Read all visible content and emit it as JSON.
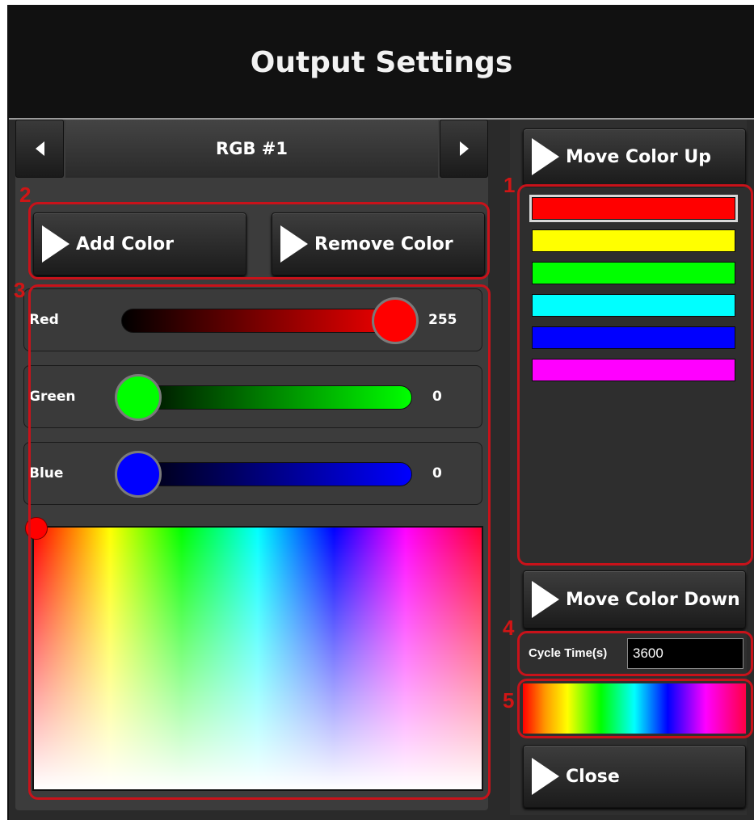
{
  "window": {
    "title": "Output Settings"
  },
  "nav": {
    "label": "RGB #1"
  },
  "buttons": {
    "add_color": "Add Color",
    "remove_color": "Remove Color",
    "move_up": "Move Color Up",
    "move_down": "Move Color Down",
    "close": "Close"
  },
  "sliders": [
    {
      "label": "Red",
      "value": "255",
      "level": 1.0,
      "color": "#ff0000"
    },
    {
      "label": "Green",
      "value": "0",
      "level": 0.0,
      "color": "#00ff00"
    },
    {
      "label": "Blue",
      "value": "0",
      "level": 0.0,
      "color": "#0000ff"
    }
  ],
  "color_list": [
    "#ff0000",
    "#ffff00",
    "#00ff00",
    "#00ffff",
    "#0000ff",
    "#ff00ff"
  ],
  "selected_color_index": 0,
  "cycle": {
    "label": "Cycle Time(s)",
    "value": "3600"
  },
  "markers": [
    "1",
    "2",
    "3",
    "4",
    "5"
  ],
  "colors": {
    "annotation": "#c8121a",
    "background": "#2a2a2a",
    "titlebar": "#111111"
  },
  "icons": {
    "prev": "triangle-left-icon",
    "next": "triangle-right-icon",
    "button": "play-triangle-icon"
  }
}
